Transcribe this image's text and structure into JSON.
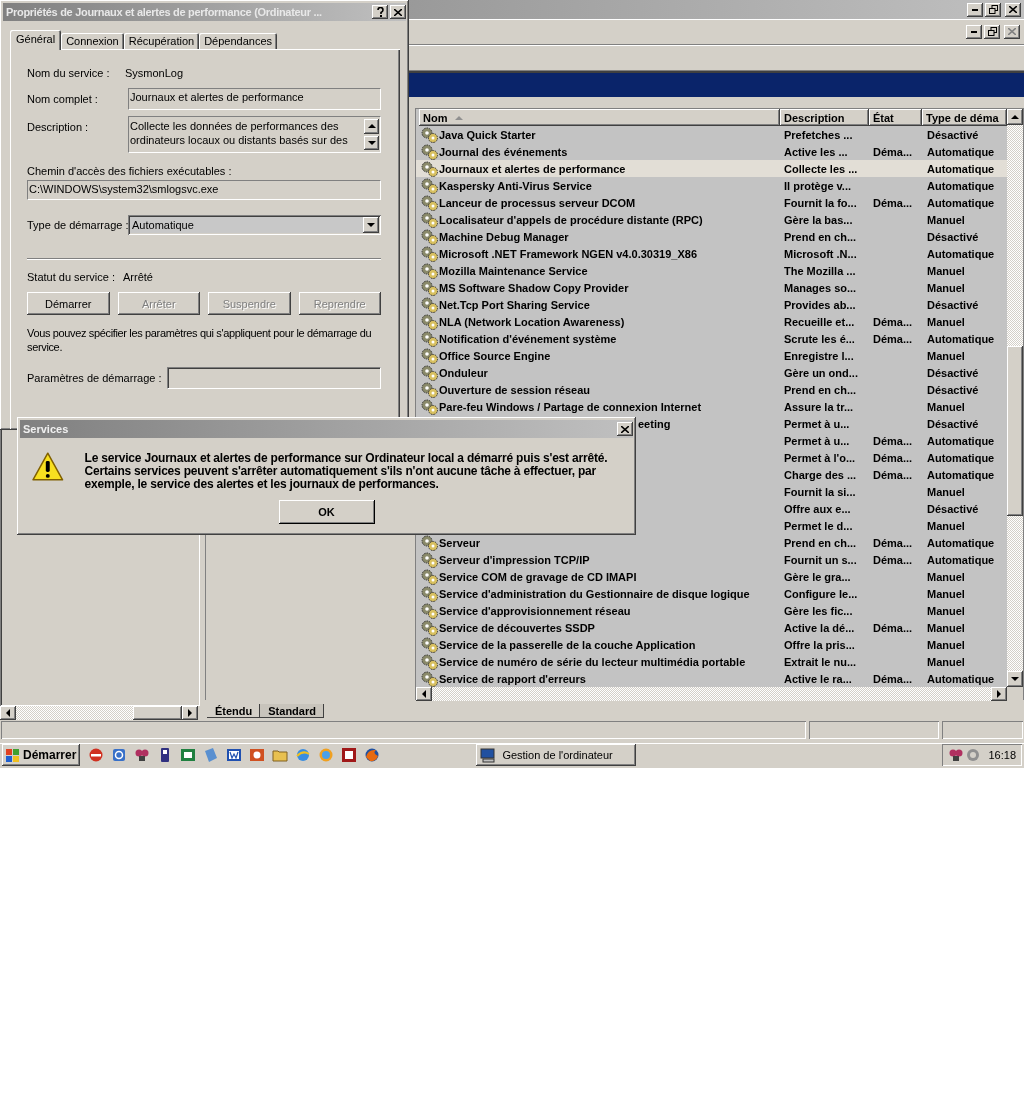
{
  "main_window": {
    "services": {
      "columns": [
        {
          "label": "Nom",
          "sorted": true
        },
        {
          "label": "Description"
        },
        {
          "label": "État"
        },
        {
          "label": "Type de déma"
        }
      ],
      "rows": [
        {
          "kind": "full",
          "name": "Java Quick Starter",
          "description": "Prefetches ...",
          "startup": "Désactivé",
          "selected": false
        },
        {
          "kind": "full",
          "name": "Journal des événements",
          "description": "Active les ...",
          "state": "Déma...",
          "startup": "Automatique",
          "selected": false
        },
        {
          "kind": "full",
          "name": "Journaux et alertes de performance",
          "description": "Collecte les ...",
          "startup": "Automatique",
          "selected": true
        },
        {
          "kind": "full",
          "name": "Kaspersky Anti-Virus Service",
          "description": "Il protège v...",
          "startup": "Automatique",
          "selected": false
        },
        {
          "kind": "full",
          "name": "Lanceur de processus serveur DCOM",
          "description": "Fournit la fo...",
          "state": "Déma...",
          "startup": "Automatique",
          "selected": false
        },
        {
          "kind": "full",
          "name": "Localisateur d'appels de procédure distante (RPC)",
          "description": "Gère la bas...",
          "startup": "Manuel",
          "selected": false
        },
        {
          "kind": "full",
          "name": "Machine Debug Manager",
          "description": "Prend en ch...",
          "startup": "Désactivé",
          "selected": false
        },
        {
          "kind": "full",
          "name": "Microsoft .NET Framework NGEN v4.0.30319_X86",
          "description": "Microsoft .N...",
          "startup": "Automatique",
          "selected": false
        },
        {
          "kind": "full",
          "name": "Mozilla Maintenance Service",
          "description": "The Mozilla ...",
          "startup": "Manuel",
          "selected": false
        },
        {
          "kind": "full",
          "name": "MS Software Shadow Copy Provider",
          "description": "Manages so...",
          "startup": "Manuel",
          "selected": false
        },
        {
          "kind": "full",
          "name": "Net.Tcp Port Sharing Service",
          "description": "Provides ab...",
          "startup": "Désactivé",
          "selected": false
        },
        {
          "kind": "full",
          "name": "NLA (Network Location Awareness)",
          "description": "Recueille et...",
          "state": "Déma...",
          "startup": "Manuel",
          "selected": false
        },
        {
          "kind": "full",
          "name": "Notification d'événement système",
          "description": "Scrute les é...",
          "state": "Déma...",
          "startup": "Automatique",
          "selected": false
        },
        {
          "kind": "full",
          "name": "Office Source Engine",
          "description": "Enregistre l...",
          "startup": "Manuel",
          "selected": false
        },
        {
          "kind": "full",
          "name": "Onduleur",
          "description": "Gère un ond...",
          "startup": "Désactivé",
          "selected": false
        },
        {
          "kind": "full",
          "name": "Ouverture de session réseau",
          "description": "Prend en ch...",
          "startup": "Désactivé",
          "selected": false
        },
        {
          "kind": "full",
          "name": "Pare-feu Windows / Partage de connexion Internet",
          "description": "Assure la tr...",
          "startup": "Manuel",
          "selected": false
        },
        {
          "kind": "tail",
          "name": "eeting",
          "description": "Permet à u...",
          "startup": "Désactivé",
          "selected": false
        },
        {
          "kind": "hidden",
          "description": "Permet à u...",
          "state": "Déma...",
          "startup": "Automatique",
          "selected": false
        },
        {
          "kind": "hidden",
          "description": "Permet à l'o...",
          "state": "Déma...",
          "startup": "Automatique",
          "selected": false
        },
        {
          "kind": "hidden",
          "description": "Charge des ...",
          "state": "Déma...",
          "startup": "Automatique",
          "selected": false
        },
        {
          "kind": "hidden",
          "description": "Fournit la si...",
          "startup": "Manuel",
          "selected": false
        },
        {
          "kind": "hidden",
          "description": "Offre aux e...",
          "startup": "Désactivé",
          "selected": false
        },
        {
          "kind": "hidden",
          "description": "Permet le d...",
          "startup": "Manuel",
          "selected": false
        },
        {
          "kind": "full",
          "name": "Serveur",
          "description": "Prend en ch...",
          "state": "Déma...",
          "startup": "Automatique",
          "selected": false
        },
        {
          "kind": "full",
          "name": "Serveur d'impression TCP/IP",
          "description": "Fournit un s...",
          "state": "Déma...",
          "startup": "Automatique",
          "selected": false
        },
        {
          "kind": "full",
          "name": "Service COM de gravage de CD IMAPI",
          "description": "Gère le gra...",
          "startup": "Manuel",
          "selected": false
        },
        {
          "kind": "full",
          "name": "Service d'administration du Gestionnaire de disque logique",
          "description": "Configure le...",
          "startup": "Manuel",
          "selected": false
        },
        {
          "kind": "full",
          "name": "Service d'approvisionnement réseau",
          "description": "Gère les fic...",
          "startup": "Manuel",
          "selected": false
        },
        {
          "kind": "full",
          "name": "Service de découvertes SSDP",
          "description": "Active la dé...",
          "state": "Déma...",
          "startup": "Manuel",
          "selected": false
        },
        {
          "kind": "full",
          "name": "Service de la passerelle de la couche Application",
          "description": "Offre la pris...",
          "startup": "Manuel",
          "selected": false
        },
        {
          "kind": "full",
          "name": "Service de numéro de série du lecteur multimédia portable",
          "description": "Extrait le nu...",
          "startup": "Manuel",
          "selected": false
        },
        {
          "kind": "full",
          "name": "Service de rapport d'erreurs",
          "description": "Active le ra...",
          "state": "Déma...",
          "startup": "Automatique",
          "selected": false
        }
      ]
    },
    "view_tabs": [
      {
        "label": "Étendu",
        "selected": true
      },
      {
        "label": "Standard",
        "selected": false
      }
    ]
  },
  "properties_dialog": {
    "title": "Propriétés de Journaux et alertes de performance (Ordinateur ...",
    "tabs": [
      {
        "label": "Général",
        "selected": true
      },
      {
        "label": "Connexion",
        "selected": false
      },
      {
        "label": "Récupération",
        "selected": false
      },
      {
        "label": "Dépendances",
        "selected": false
      }
    ],
    "service_name": {
      "label": "Nom du service :",
      "value": "SysmonLog"
    },
    "display_name": {
      "label": "Nom complet :",
      "value": "Journaux et alertes de performance"
    },
    "description": {
      "label": "Description :",
      "lines": [
        "Collecte les données de performances des",
        "ordinateurs locaux ou distants basés sur des"
      ]
    },
    "path": {
      "label": "Chemin d'accès des fichiers exécutables :",
      "value": "C:\\WINDOWS\\system32\\smlogsvc.exe"
    },
    "startup_type": {
      "label": "Type de démarrage :",
      "value": "Automatique"
    },
    "status": {
      "label": "Statut du service :",
      "value": "Arrêté"
    },
    "buttons": [
      {
        "label": "Démarrer",
        "disabled": false
      },
      {
        "label": "Arrêter",
        "disabled": true
      },
      {
        "label": "Suspendre",
        "disabled": true
      },
      {
        "label": "Reprendre",
        "disabled": true
      }
    ],
    "hint": "Vous pouvez spécifier les paramètres qui s'appliquent pour le démarrage du service.",
    "parameters": {
      "label": "Paramètres de démarrage :",
      "disabled": true
    }
  },
  "message_box": {
    "title": "Services",
    "text": "Le service Journaux et alertes de performance sur Ordinateur local a démarré puis s'est arrêté. Certains services peuvent s'arrêter automatiquement s'ils n'ont aucune tâche à effectuer, par exemple, le service des alertes et les journaux de performances.",
    "button": "OK"
  },
  "taskbar": {
    "start": "Démarrer",
    "task": "Gestion de l'ordinateur",
    "clock": "16:18"
  }
}
